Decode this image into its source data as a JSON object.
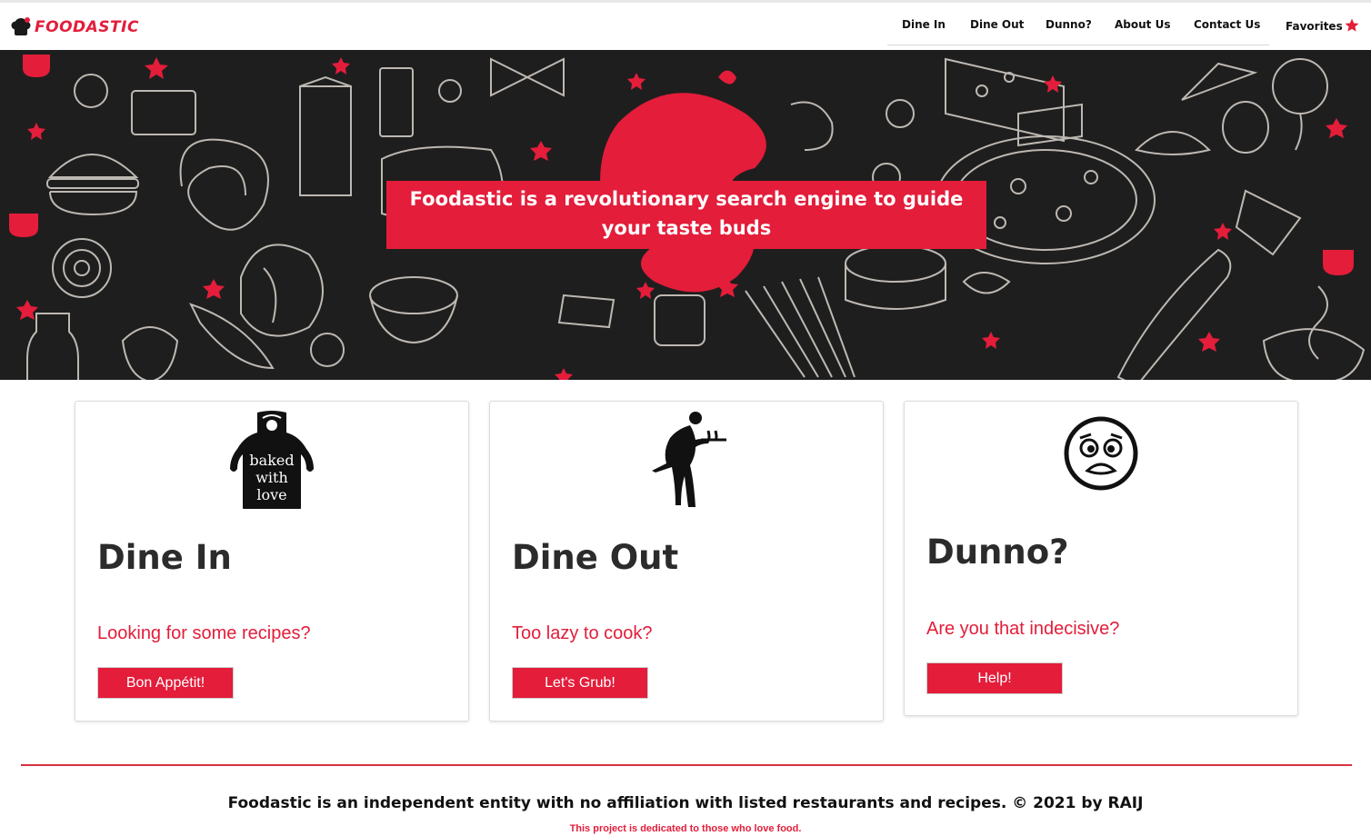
{
  "brand": {
    "name": "FOODASTIC",
    "accent": "#e31d3a"
  },
  "nav": {
    "items": [
      {
        "label": "Dine In"
      },
      {
        "label": "Dine Out"
      },
      {
        "label": "Dunno?"
      },
      {
        "label": "About Us"
      },
      {
        "label": "Contact Us"
      }
    ],
    "favorites_label": "Favorites",
    "favorites_icon": "star-icon"
  },
  "hero": {
    "tagline": "Foodastic is a revolutionary search engine to guide your taste buds",
    "background": "food-doodle-pattern",
    "bg_color": "#1f1e1e"
  },
  "cards": [
    {
      "icon": "apron-icon",
      "icon_text": [
        "baked",
        "with",
        "love"
      ],
      "title": "Dine In",
      "subtitle": "Looking for some recipes?",
      "button": "Bon Appétit!"
    },
    {
      "icon": "waiter-icon",
      "title": "Dine Out",
      "subtitle": "Too lazy to cook?",
      "button": "Let's Grub!"
    },
    {
      "icon": "worried-face-icon",
      "title": "Dunno?",
      "subtitle": "Are you that indecisive?",
      "button": "Help!"
    }
  ],
  "footer": {
    "text": "Foodastic is an independent entity with no affiliation with listed restaurants and recipes. © 2021 by RAIJ",
    "dedication": "This project is dedicated to those who love food."
  }
}
